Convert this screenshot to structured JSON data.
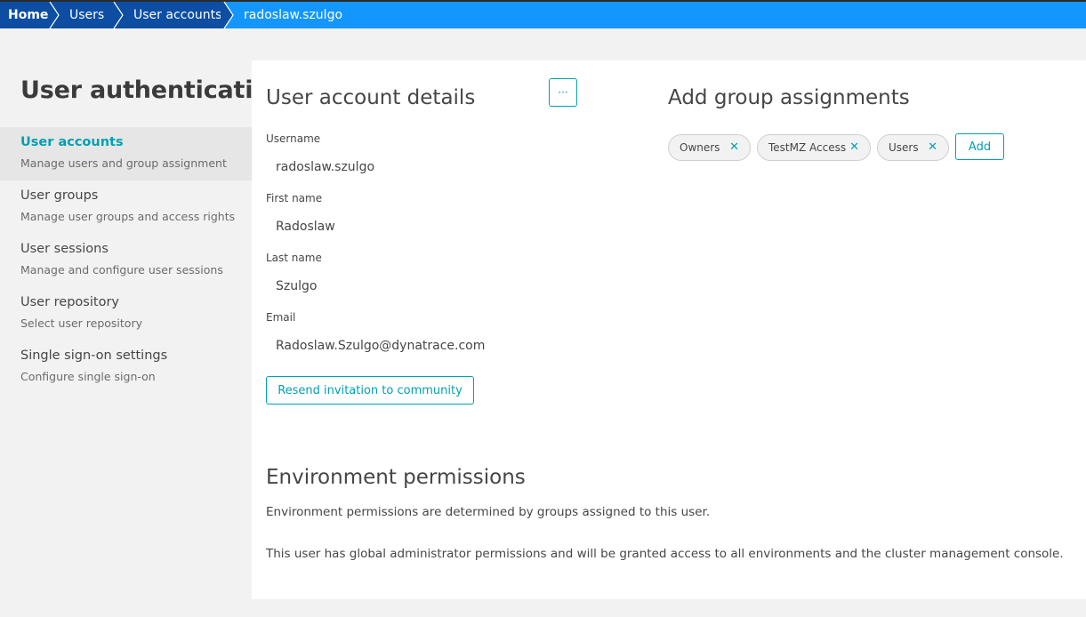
{
  "breadcrumb": {
    "home": "Home",
    "users": "Users",
    "user_accounts": "User accounts",
    "current": "radoslaw.szulgo"
  },
  "sidebar": {
    "title": "User authentication",
    "items": [
      {
        "label": "User accounts",
        "desc": "Manage users and group assignment",
        "active": true
      },
      {
        "label": "User groups",
        "desc": "Manage user groups and access rights",
        "active": false
      },
      {
        "label": "User sessions",
        "desc": "Manage and configure user sessions",
        "active": false
      },
      {
        "label": "User repository",
        "desc": "Select user repository",
        "active": false
      },
      {
        "label": "Single sign-on settings",
        "desc": "Configure single sign-on",
        "active": false
      }
    ]
  },
  "details": {
    "title": "User account details",
    "more_label": "···",
    "username_label": "Username",
    "username": "radoslaw.szulgo",
    "first_name_label": "First name",
    "first_name": "Radoslaw",
    "last_name_label": "Last name",
    "last_name": "Szulgo",
    "email_label": "Email",
    "email": "Radoslaw.Szulgo@dynatrace.com",
    "resend_label": "Resend invitation to community"
  },
  "groups": {
    "title": "Add group assignments",
    "chips": [
      "Owners",
      "TestMZ Access",
      "Users"
    ],
    "remove_glyph": "✕",
    "add_label": "Add"
  },
  "permissions": {
    "title": "Environment permissions",
    "text1": "Environment permissions are determined by groups assigned to this user.",
    "text2": "This user has global administrator permissions and will be granted access to all environments and the cluster management console."
  },
  "colors": {
    "accent": "#00a1b2",
    "breadcrumb_bg": "#1496ff",
    "breadcrumb_dark": "#0d4ea3"
  }
}
